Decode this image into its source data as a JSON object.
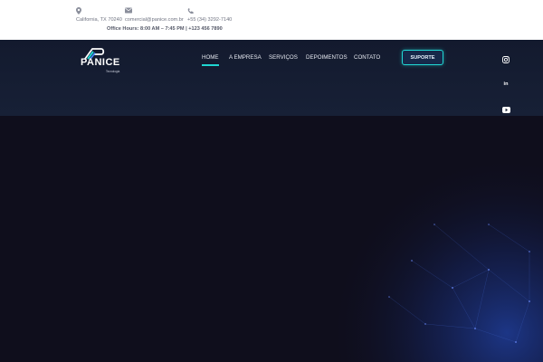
{
  "topbar": {
    "address": "California, TX 70240",
    "email": "comercial@panice.com.br",
    "phone": "+55 (34) 3292-7140",
    "hours": "Office Hours: 8:00 AM – 7:45 PM | +123 456 7890",
    "icons": [
      "map-pin-icon",
      "envelope-icon",
      "phone-icon"
    ]
  },
  "brand": {
    "name": "PANICE",
    "tagline": "Tecnologia",
    "accent": "#1fd6d2"
  },
  "nav": {
    "items": [
      {
        "label": "HOME",
        "active": true
      },
      {
        "label": "A EMPRESA",
        "active": false
      },
      {
        "label": "SERVIÇOS",
        "active": false
      },
      {
        "label": "DEPOIMENTOS",
        "active": false
      },
      {
        "label": "CONTATO",
        "active": false
      }
    ],
    "cta": "SUPORTE"
  },
  "social": {
    "icons": [
      "instagram-icon",
      "linkedin-icon",
      "youtube-icon"
    ],
    "linkedin_glyph": "in"
  },
  "colors": {
    "header_bg": "#131a2e",
    "hero_bg": "#0f0e1c",
    "hero_glow": "#1c3a8a"
  }
}
